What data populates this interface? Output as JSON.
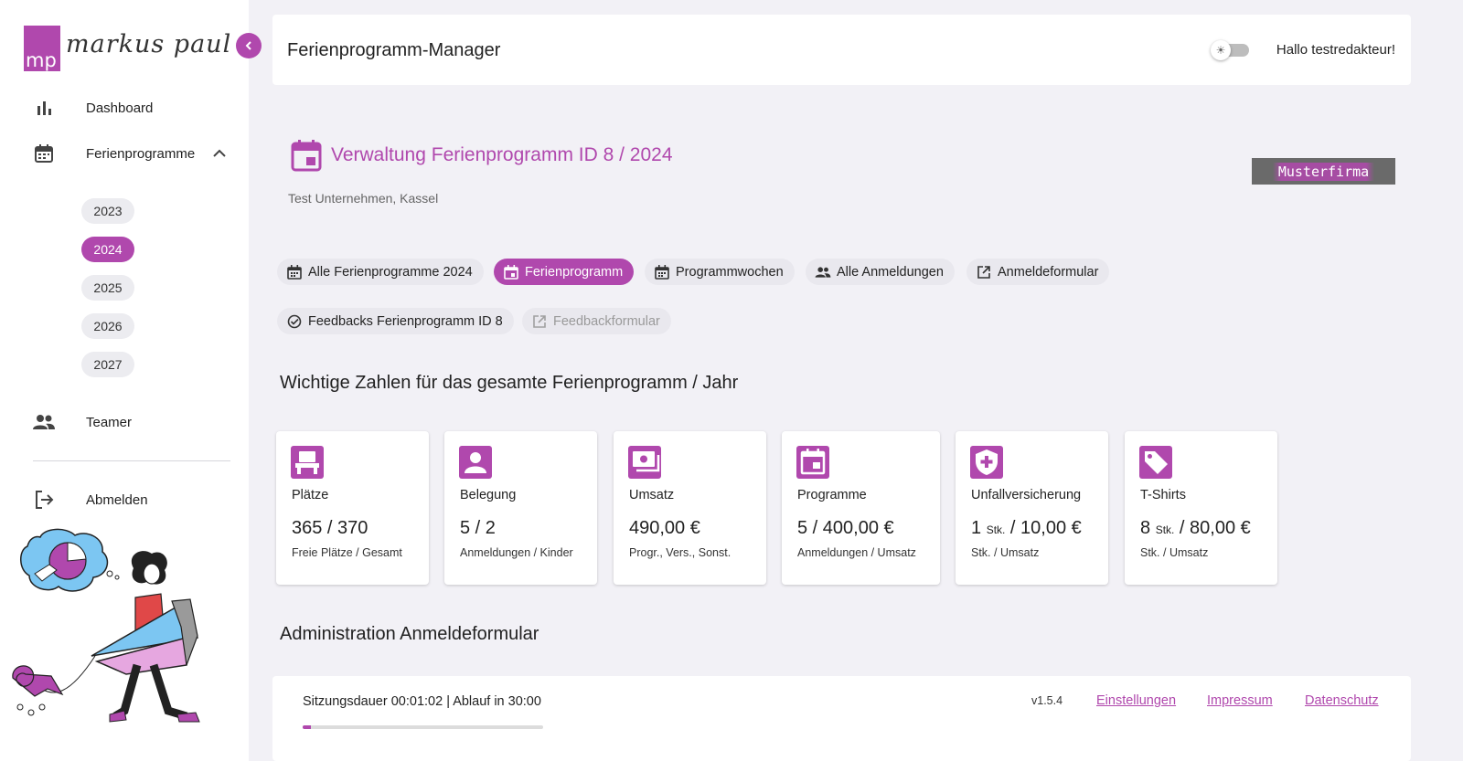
{
  "brand": {
    "logo_initials": "mp",
    "logo_name": "markus paul"
  },
  "sidebar": {
    "items": [
      {
        "label": "Dashboard",
        "icon": "bar-chart-icon"
      },
      {
        "label": "Ferienprogramme",
        "icon": "calendar-icon"
      },
      {
        "label": "Teamer",
        "icon": "people-icon"
      },
      {
        "label": "Abmelden",
        "icon": "logout-icon"
      }
    ],
    "years": [
      "2023",
      "2024",
      "2025",
      "2026",
      "2027"
    ],
    "active_year": "2024"
  },
  "header": {
    "title": "Ferienprogramm-Manager",
    "greeting": "Hallo testredakteur!"
  },
  "page": {
    "title": "Verwaltung Ferienprogramm ID 8 / 2024",
    "subtitle": "Test Unternehmen, Kassel",
    "company_tag": "Musterfirma"
  },
  "tabs": [
    {
      "label": "Alle Ferienprogramme 2024",
      "icon": "calendar-month-icon"
    },
    {
      "label": "Ferienprogramm",
      "icon": "event-icon",
      "active": true
    },
    {
      "label": "Programmwochen",
      "icon": "calendar-month-icon"
    },
    {
      "label": "Alle Anmeldungen",
      "icon": "people-icon"
    },
    {
      "label": "Anmeldeformular",
      "icon": "open-in-new-icon"
    },
    {
      "label": "Feedbacks Ferienprogramm ID 8",
      "icon": "check-circle-icon"
    },
    {
      "label": "Feedbackformular",
      "icon": "open-in-new-icon",
      "disabled": true
    }
  ],
  "stats_section_title": "Wichtige Zahlen für das gesamte Ferienprogramm / Jahr",
  "stats": [
    {
      "label": "Plätze",
      "value": "365 / 370",
      "note": "Freie Plätze / Gesamt",
      "icon": "seat-icon"
    },
    {
      "label": "Belegung",
      "value": "5 / 2",
      "note": "Anmeldungen / Kinder",
      "icon": "account-box-icon"
    },
    {
      "label": "Umsatz",
      "value": "490,00 €",
      "note": "Progr., Vers., Sonst.",
      "icon": "payments-icon"
    },
    {
      "label": "Programme",
      "value": "5 / 400,00 €",
      "note": "Anmeldungen / Umsatz",
      "icon": "event-icon"
    },
    {
      "label": "Unfallversicherung",
      "value_count": "1",
      "value_unit": "Stk.",
      "value_rest": "/ 10,00 €",
      "note": "Stk. / Umsatz",
      "icon": "shield-plus-icon"
    },
    {
      "label": "T-Shirts",
      "value_count": "8",
      "value_unit": "Stk.",
      "value_rest": "/ 80,00 €",
      "note": "Stk. / Umsatz",
      "icon": "tag-icon"
    }
  ],
  "admin_section_title": "Administration Anmeldeformular",
  "footer": {
    "session": "Sitzungsdauer 00:01:02 | Ablauf in 30:00",
    "session_progress": 0.034,
    "version": "v1.5.4",
    "links": [
      "Einstellungen",
      "Impressum",
      "Datenschutz"
    ]
  },
  "colors": {
    "accent": "#b048ad",
    "background": "#f2f1f6",
    "card": "#ffffff"
  }
}
